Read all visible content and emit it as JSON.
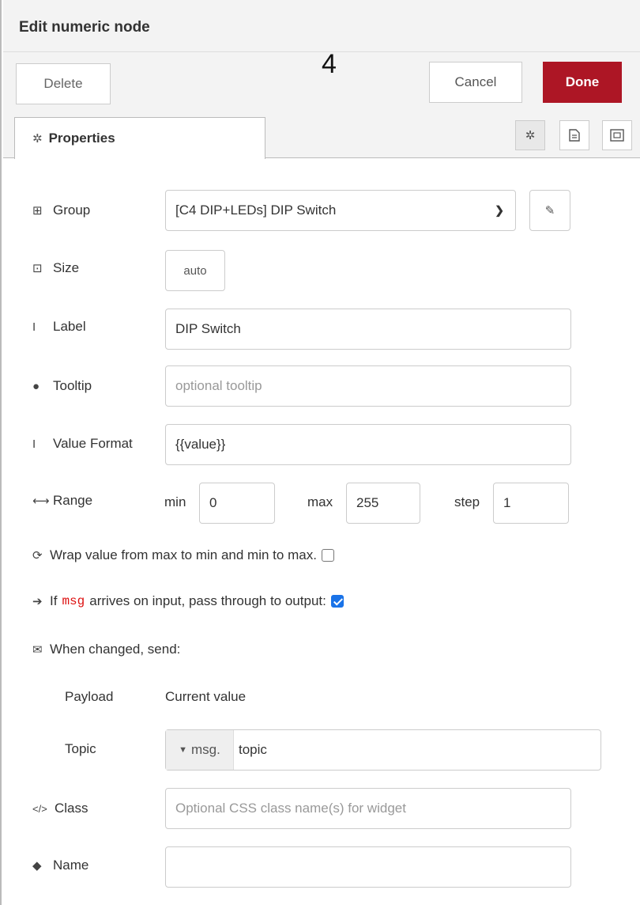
{
  "header": {
    "title": "Edit numeric node",
    "overlay_number": "4"
  },
  "toolbar": {
    "delete_label": "Delete",
    "cancel_label": "Cancel",
    "done_label": "Done"
  },
  "tabs": {
    "properties_label": "Properties"
  },
  "form": {
    "group": {
      "label": "Group",
      "value": "[C4 DIP+LEDs] DIP Switch"
    },
    "size": {
      "label": "Size",
      "value": "auto"
    },
    "label": {
      "label": "Label",
      "value": "DIP Switch"
    },
    "tooltip": {
      "label": "Tooltip",
      "placeholder": "optional tooltip"
    },
    "value_format": {
      "label": "Value Format",
      "value": "{{value}}"
    },
    "range": {
      "label": "Range",
      "min_label": "min",
      "min_value": "0",
      "max_label": "max",
      "max_value": "255",
      "step_label": "step",
      "step_value": "1"
    },
    "wrap": {
      "label": "Wrap value from max to min and min to max.",
      "checked": false
    },
    "passthrough": {
      "label_pre": "If",
      "label_code": "msg",
      "label_post": "arrives on input, pass through to output:",
      "checked": true
    },
    "when_changed": {
      "label": "When changed, send:"
    },
    "payload": {
      "label": "Payload",
      "value": "Current value"
    },
    "topic": {
      "label": "Topic",
      "type_label": "msg.",
      "value": "topic"
    },
    "class": {
      "label": "Class",
      "placeholder": "Optional CSS class name(s) for widget"
    },
    "name": {
      "label": "Name",
      "value": ""
    }
  },
  "colors": {
    "done_bg": "#ad1625",
    "checkbox_checked": "#1a73e8",
    "code_text": "#dd1111"
  }
}
